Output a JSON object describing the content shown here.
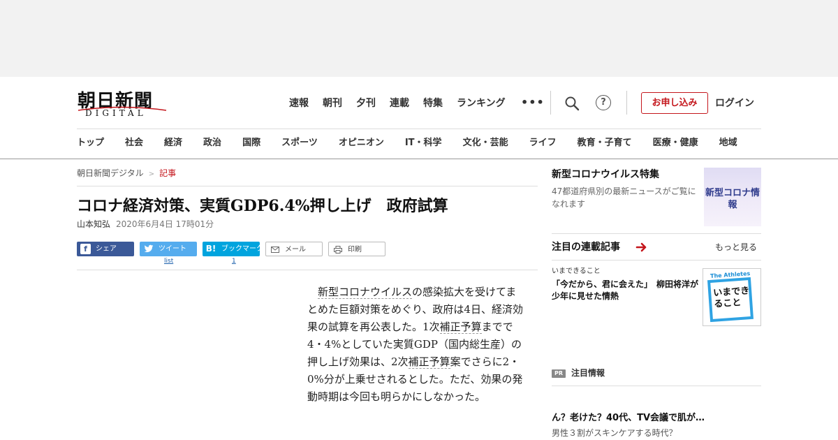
{
  "logo": {
    "kanji": "朝日新聞",
    "sub": "DIGITAL"
  },
  "topnav": [
    "速報",
    "朝刊",
    "夕刊",
    "連載",
    "特集",
    "ランキング"
  ],
  "header": {
    "more": "•••",
    "help": "?",
    "apply_label": "お申し込み",
    "login_label": "ログイン"
  },
  "catnav": [
    "トップ",
    "社会",
    "経済",
    "政治",
    "国際",
    "スポーツ",
    "オピニオン",
    "IT・科学",
    "文化・芸能",
    "ライフ",
    "教育・子育て",
    "医療・健康",
    "地域"
  ],
  "breadcrumb": {
    "home": "朝日新聞デジタル",
    "sep": ">",
    "current": "記事"
  },
  "article": {
    "headline": "コロナ経済対策、実質GDP6.4%押し上げ　政府試算",
    "author": "山本知弘",
    "date": "2020年6月4日 17時01分",
    "body": {
      "t1": "新型コロナウイルス",
      "t2": "の感染拡大を受けてまとめた巨額対策をめぐり、政府は4日、経済効果の試算を再公表した。1次",
      "t3": "補正予算",
      "t4": "までで4・4%としていた実質GDP（国内総生産）の押し上げ効果は、2次",
      "t5": "補正予算",
      "t6": "案でさらに2・0%分が上乗せされるとした。ただ、効果の発動時期は今回も明らかにしなかった。"
    }
  },
  "share": {
    "facebook": {
      "icon": "f",
      "label": "シェア"
    },
    "twitter": {
      "icon": "🐦",
      "label": "ツイート",
      "count": "list"
    },
    "hatena": {
      "icon": "B!",
      "label": "ブックマーク",
      "count": "1"
    },
    "mail": {
      "label": "メール"
    },
    "print": {
      "label": "印刷"
    }
  },
  "sidebar": {
    "special": {
      "title": "新型コロナウイルス特集",
      "desc": "47都道府県別の最新ニュースがご覧になれます",
      "thumb_text": "新型コロナ情報"
    },
    "series": {
      "heading": "注目の連載記事",
      "more": "もっと見る",
      "kicker": "いまできること",
      "title": "「今だから、君に会えた」　柳田将洋が少年に見せた情熱",
      "thumb_tag": "The Athletes",
      "thumb_text": "いまできること"
    },
    "pr": {
      "badge": "PR",
      "label": "注目情報",
      "title": "ん？老けた？40代、TV会議で肌が…",
      "sub": "男性３割がスキンケアする時代？"
    }
  },
  "colors": {
    "brand_red": "#c4161c",
    "facebook": "#3b5998",
    "twitter": "#55acee",
    "hatena": "#00a4de"
  }
}
